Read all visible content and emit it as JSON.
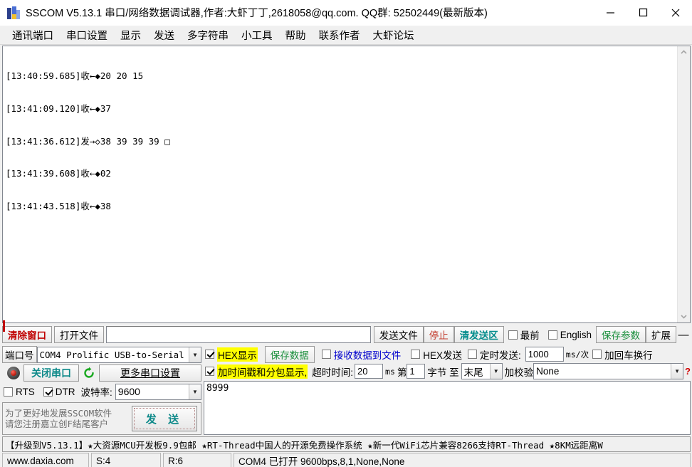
{
  "window": {
    "title": "SSCOM V5.13.1 串口/网络数据调试器,作者:大虾丁丁,2618058@qq.com. QQ群: 52502449(最新版本)",
    "minimize_label": "minimize",
    "maximize_label": "maximize",
    "close_label": "close"
  },
  "menubar": {
    "items": [
      {
        "label": "通讯端口"
      },
      {
        "label": "串口设置"
      },
      {
        "label": "显示"
      },
      {
        "label": "发送"
      },
      {
        "label": "多字符串"
      },
      {
        "label": "小工具"
      },
      {
        "label": "帮助"
      },
      {
        "label": "联系作者"
      },
      {
        "label": "大虾论坛"
      }
    ]
  },
  "receive": {
    "lines": [
      "[13:40:59.685]收←◆20 20 15",
      "[13:41:09.120]收←◆37",
      "[13:41:36.612]发→◇38 39 39 39 □",
      "[13:41:39.608]收←◆02",
      "[13:41:43.518]收←◆38"
    ]
  },
  "toolbar": {
    "clear_window": "清除窗口",
    "open_file": "打开文件",
    "file_path_value": "",
    "file_path_placeholder": "",
    "send_file": "发送文件",
    "stop": "停止",
    "clear_send": "清发送区",
    "topmost_label": "最前",
    "topmost_checked": false,
    "english_label": "English",
    "english_checked": false,
    "save_params": "保存参数",
    "extend": "扩展",
    "collapse": "—"
  },
  "port_settings": {
    "port_label": "端口号",
    "port_value": "COM4 Prolific USB-to-Serial",
    "close_port_button": "关闭串口",
    "refresh_icon": "refresh-icon",
    "more_settings": "更多串口设置",
    "rts_label": "RTS",
    "rts_checked": false,
    "dtr_label": "DTR",
    "dtr_checked": true,
    "baud_label": "波特率:",
    "baud_value": "9600"
  },
  "promo_panel": {
    "line1": "为了更好地发展SSCOM软件",
    "line2": "请您注册嘉立创F结尾客户",
    "send_button": "发 送"
  },
  "options": {
    "hex_display_label": "HEX显示",
    "hex_display_checked": true,
    "save_data_button": "保存数据",
    "recv_to_file_label": "接收数据到文件",
    "recv_to_file_checked": false,
    "hex_send_label": "HEX发送",
    "hex_send_checked": false,
    "timed_send_label": "定时发送:",
    "timed_send_checked": false,
    "timed_send_value": "1000",
    "timed_send_unit": "ms/次",
    "crlf_label": "加回车换行",
    "crlf_checked": false,
    "timestamp_label": "加时间戳和分包显示,",
    "timestamp_checked": true,
    "timeout_label": "超时时间:",
    "timeout_value": "20",
    "timeout_unit": "ms",
    "byte_from_label": "第",
    "byte_from_value": "1",
    "byte_mid_label": "字节 至",
    "byte_to_value": "末尾",
    "checksum_label": "加校验",
    "checksum_value": "None",
    "help_marker": "?"
  },
  "send_area": {
    "value": "8999"
  },
  "banner": {
    "text": "【升级到V5.13.1】★大资源MCU开发板9.9包邮 ★RT-Thread中国人的开源免费操作系统 ★新一代WiFi芯片兼容8266支持RT-Thread ★8KM远距离W"
  },
  "statusbar": {
    "site": "www.daxia.com",
    "sent": "S:4",
    "received": "R:6",
    "port_status": "COM4 已打开  9600bps,8,1,None,None"
  }
}
